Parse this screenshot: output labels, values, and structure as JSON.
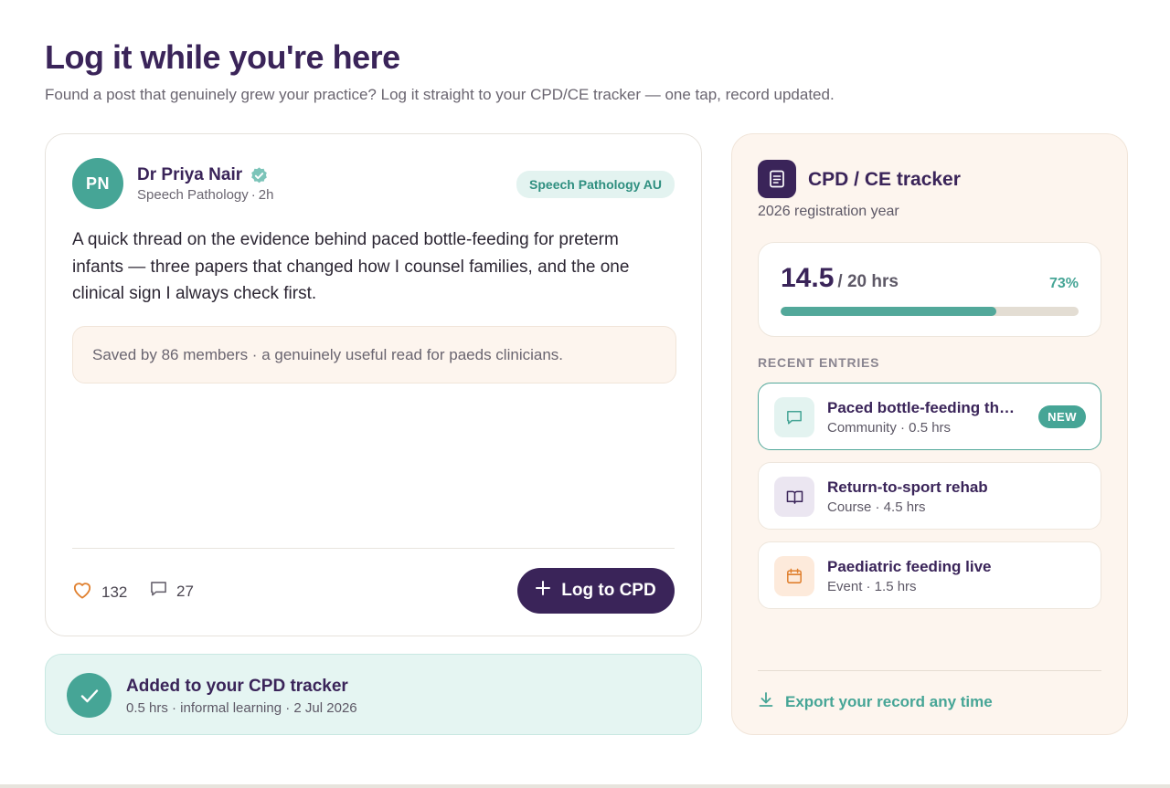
{
  "header": {
    "title": "Log it while you're here",
    "subtitle": "Found a post that genuinely grew your practice? Log it straight to your CPD/CE tracker — one tap, record updated."
  },
  "post": {
    "avatar_initials": "PN",
    "author_name": "Dr Priya Nair",
    "author_role": "Speech Pathology",
    "posted_ago": "2h",
    "community_tag": "Speech Pathology AU",
    "body": "A quick thread on the evidence behind paced bottle-feeding for preterm infants — three papers that changed how I counsel families, and the one clinical sign I always check first.",
    "saved_note": "Saved by 86 members · a genuinely useful read for paeds clinicians.",
    "likes": "132",
    "comments": "27",
    "log_button_label": "Log to CPD"
  },
  "added_banner": {
    "title": "Added to your CPD tracker",
    "meta": "0.5 hrs · informal learning · 2 Jul 2026"
  },
  "tracker": {
    "title": "CPD / CE tracker",
    "year": "2026 registration year",
    "hours_logged": "14.5",
    "hours_total": "/ 20 hrs",
    "percent": "73%",
    "progress_fraction": 0.725,
    "recent_label": "RECENT ENTRIES",
    "entries": [
      {
        "title": "Paced bottle-feeding th…",
        "meta": "Community · 0.5 hrs",
        "badge": "NEW",
        "icon": "comment-icon",
        "color": "#46a596"
      },
      {
        "title": "Return-to-sport rehab",
        "meta": "Course · 4.5 hrs",
        "icon": "book-icon",
        "color": "#3a2459"
      },
      {
        "title": "Paediatric feeding live",
        "meta": "Event · 1.5 hrs",
        "icon": "calendar-icon",
        "color": "#e0802f"
      }
    ],
    "export_label": "Export your record any time"
  },
  "colors": {
    "brand_purple": "#3a2459",
    "teal": "#46a596",
    "cream": "#fdf5ee",
    "orange": "#e0802f"
  }
}
